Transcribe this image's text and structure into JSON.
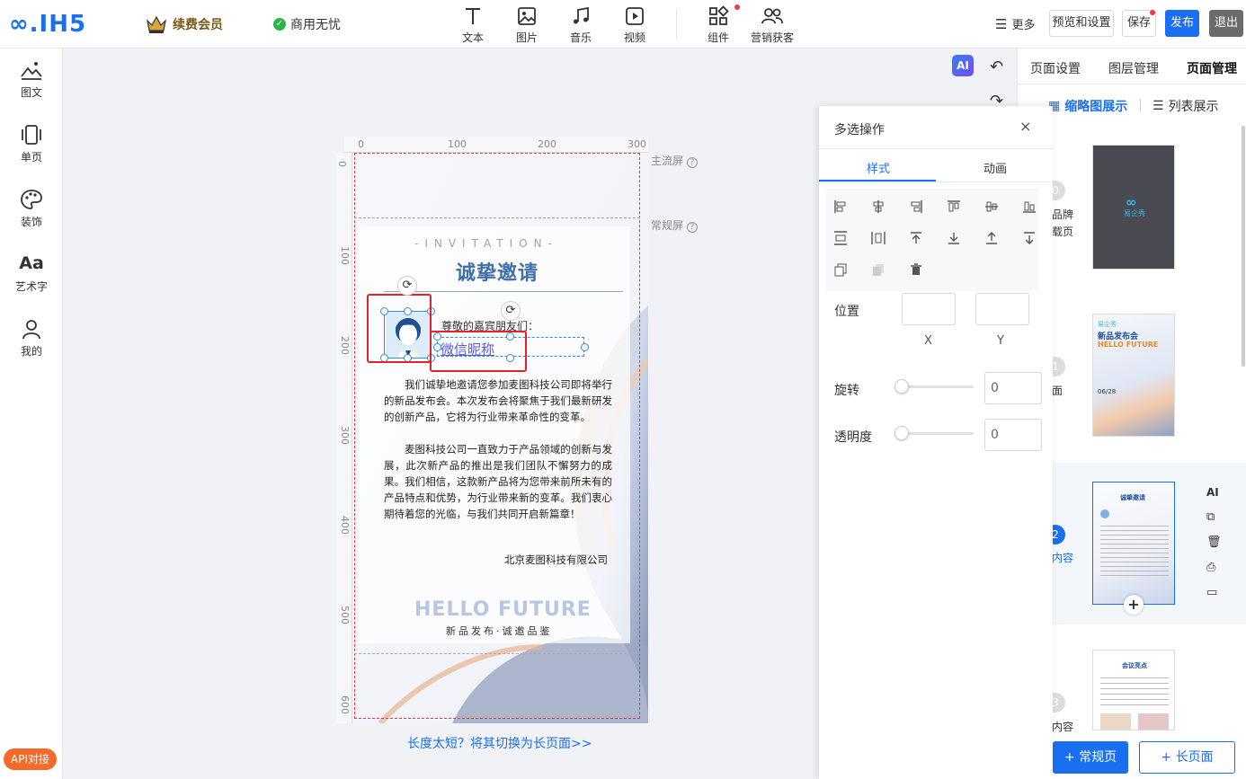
{
  "topbar": {
    "logo": "∞.IH5",
    "vip": "续费会员",
    "commercial": "商用无忧",
    "tools": {
      "text": "文本",
      "image": "图片",
      "music": "音乐",
      "video": "视频",
      "component": "组件",
      "marketing": "营销获客"
    },
    "more": "更多",
    "preview": "预览和设置",
    "save": "保存",
    "publish": "发布",
    "exit": "退出"
  },
  "leftbar": {
    "items": [
      "图文",
      "单页",
      "装饰",
      "艺术字",
      "我的"
    ],
    "api": "API对接"
  },
  "canvas": {
    "ruler_top": [
      "0",
      "100",
      "200",
      "300"
    ],
    "ruler_left": [
      "0",
      "100",
      "200",
      "300",
      "400",
      "500",
      "600"
    ],
    "main_screen": "主流屏",
    "normal_screen": "常规屏",
    "switch_link": "长度太短？将其切换为长页面>>"
  },
  "invitation": {
    "subtitle": "-INVITATION-",
    "title": "诚挚邀请",
    "greeting": "尊敬的嘉宾朋友们：",
    "nickname": "微信昵称",
    "para1": "我们诚挚地邀请您参加麦图科技公司即将举行的新品发布会。本次发布会将聚焦于我们最新研发的创新产品，它将为行业带来革命性的变革。",
    "para2": "麦图科技公司一直致力于产品领域的创新与发展，此次新产品的推出是我们团队不懈努力的成果。我们相信，这款新产品将为您带来前所未有的产品特点和优势，为行业带来新的变革。我们衷心期待着您的光临，与我们共同开启新篇章！",
    "signature": "北京麦图科技有限公司",
    "hello": "HELLO FUTURE",
    "hello_sub": "新品发布·诚邀品鉴"
  },
  "ai_badge": "AI",
  "rightpanel": {
    "tabs": [
      "页面设置",
      "图层管理",
      "页面管理"
    ],
    "view_thumb": "缩略图展示",
    "view_list": "列表展示",
    "pages": [
      {
        "num": "0",
        "label": "品牌\n载页"
      },
      {
        "num": "1",
        "label": "面"
      },
      {
        "num": "2",
        "label": "内容"
      },
      {
        "num": "3",
        "label": "内容"
      }
    ],
    "thumb1_brand": "易企秀",
    "thumb2_text": [
      "易企秀",
      "新品发布会",
      "HELLO FUTURE",
      "06/28"
    ],
    "thumb3_title": "诚挚邀请",
    "thumb4_title": "会议亮点",
    "page_actions": [
      "AI"
    ],
    "add_normal": "+ 常规页",
    "add_long": "+ 长页面"
  },
  "multi": {
    "title": "多选操作",
    "close": "×",
    "tabs": [
      "样式",
      "动画"
    ],
    "position": "位置",
    "x": "X",
    "y": "Y",
    "rotate": "旋转",
    "rotate_value": "0",
    "opacity": "透明度",
    "opacity_value": "0"
  },
  "colors": {
    "accent": "#1a6ef0",
    "danger": "#e32229",
    "vip": "#7a5a1a",
    "selection": "#2f8de4"
  }
}
